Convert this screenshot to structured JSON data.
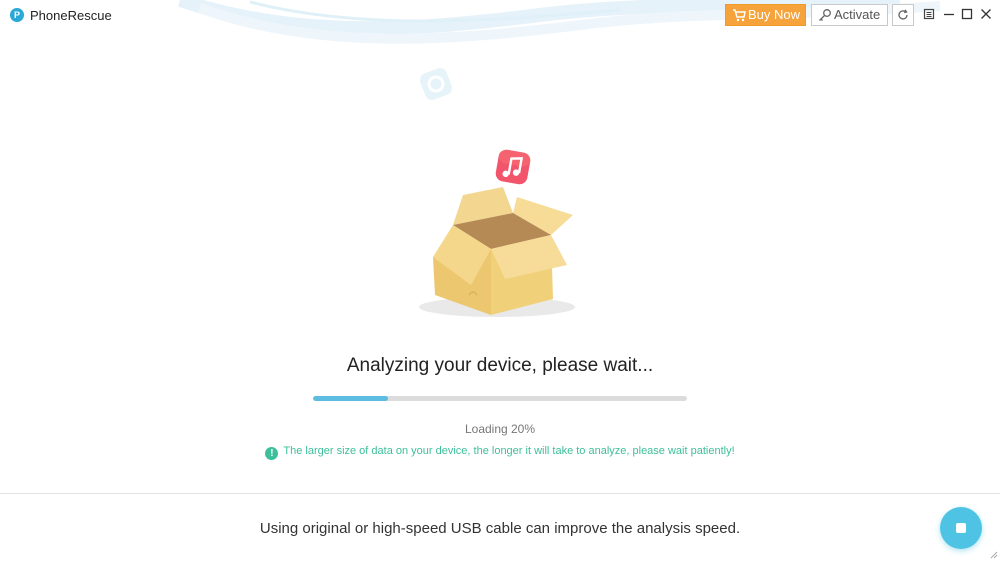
{
  "app": {
    "title": "PhoneRescue",
    "logo_letter": "P"
  },
  "toolbar": {
    "buy_label": "Buy Now",
    "activate_label": "Activate"
  },
  "analysis": {
    "heading": "Analyzing your device, please wait...",
    "progress_percent": 20,
    "loading_text": "Loading 20%",
    "hint_icon": "!",
    "hint_text": "The larger size of data on your device, the longer it will take to analyze, please wait patiently!"
  },
  "footer": {
    "tip": "Using original or high-speed USB cable can improve the analysis speed."
  },
  "colors": {
    "accent": "#4fc3e3",
    "buy": "#f5a33a",
    "hint": "#3dbf9a",
    "progress": "#5cbde0"
  }
}
